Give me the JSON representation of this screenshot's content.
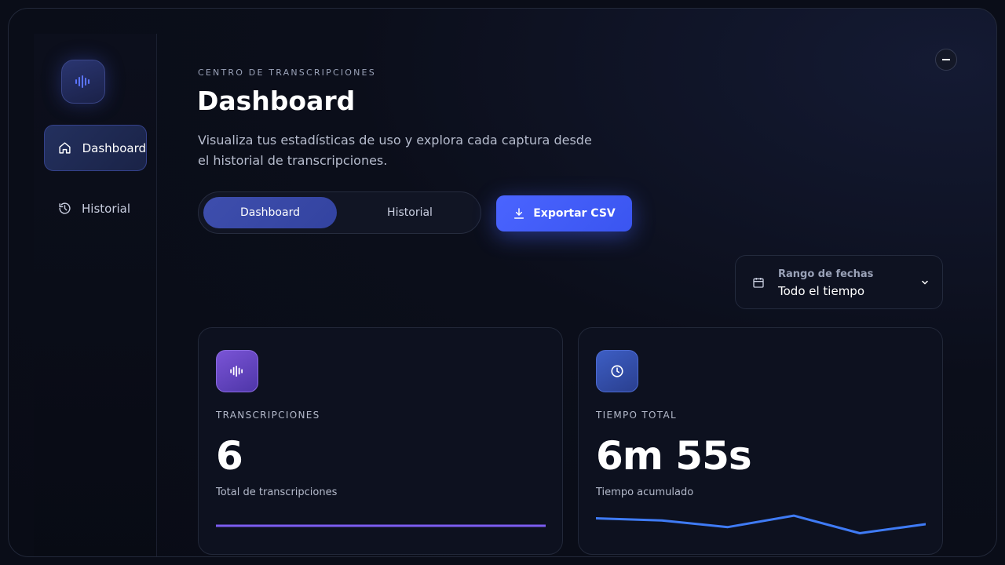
{
  "sidebar": {
    "logo_icon": "waveform-icon",
    "items": [
      {
        "label": "Dashboard",
        "icon": "home-icon",
        "active": true
      },
      {
        "label": "Historial",
        "icon": "history-icon",
        "active": false
      }
    ]
  },
  "header": {
    "eyebrow": "CENTRO DE TRANSCRIPCIONES",
    "title": "Dashboard",
    "subtitle": "Visualiza tus estadísticas de uso y explora cada captura desde el historial de transcripciones."
  },
  "tabs": [
    {
      "label": "Dashboard",
      "active": true
    },
    {
      "label": "Historial",
      "active": false
    }
  ],
  "export_button": {
    "label": "Exportar CSV",
    "icon": "download-icon"
  },
  "date_range": {
    "label": "Rango de fechas",
    "value": "Todo el tiempo"
  },
  "cards": [
    {
      "icon": "waveform-icon",
      "label": "TRANSCRIPCIONES",
      "value": "6",
      "description": "Total de transcripciones",
      "sparkline": [
        0.5,
        0.5,
        0.5,
        0.5,
        0.5,
        0.5
      ],
      "color": "#7b5cf0"
    },
    {
      "icon": "clock-icon",
      "label": "TIEMPO TOTAL",
      "value": "6m 55s",
      "description": "Tiempo acumulado",
      "sparkline": [
        0.78,
        0.7,
        0.45,
        0.88,
        0.22,
        0.56
      ],
      "color": "#3f7bf5"
    }
  ],
  "colors": {
    "accent": "#4a64ff",
    "background": "#0a0d18"
  }
}
